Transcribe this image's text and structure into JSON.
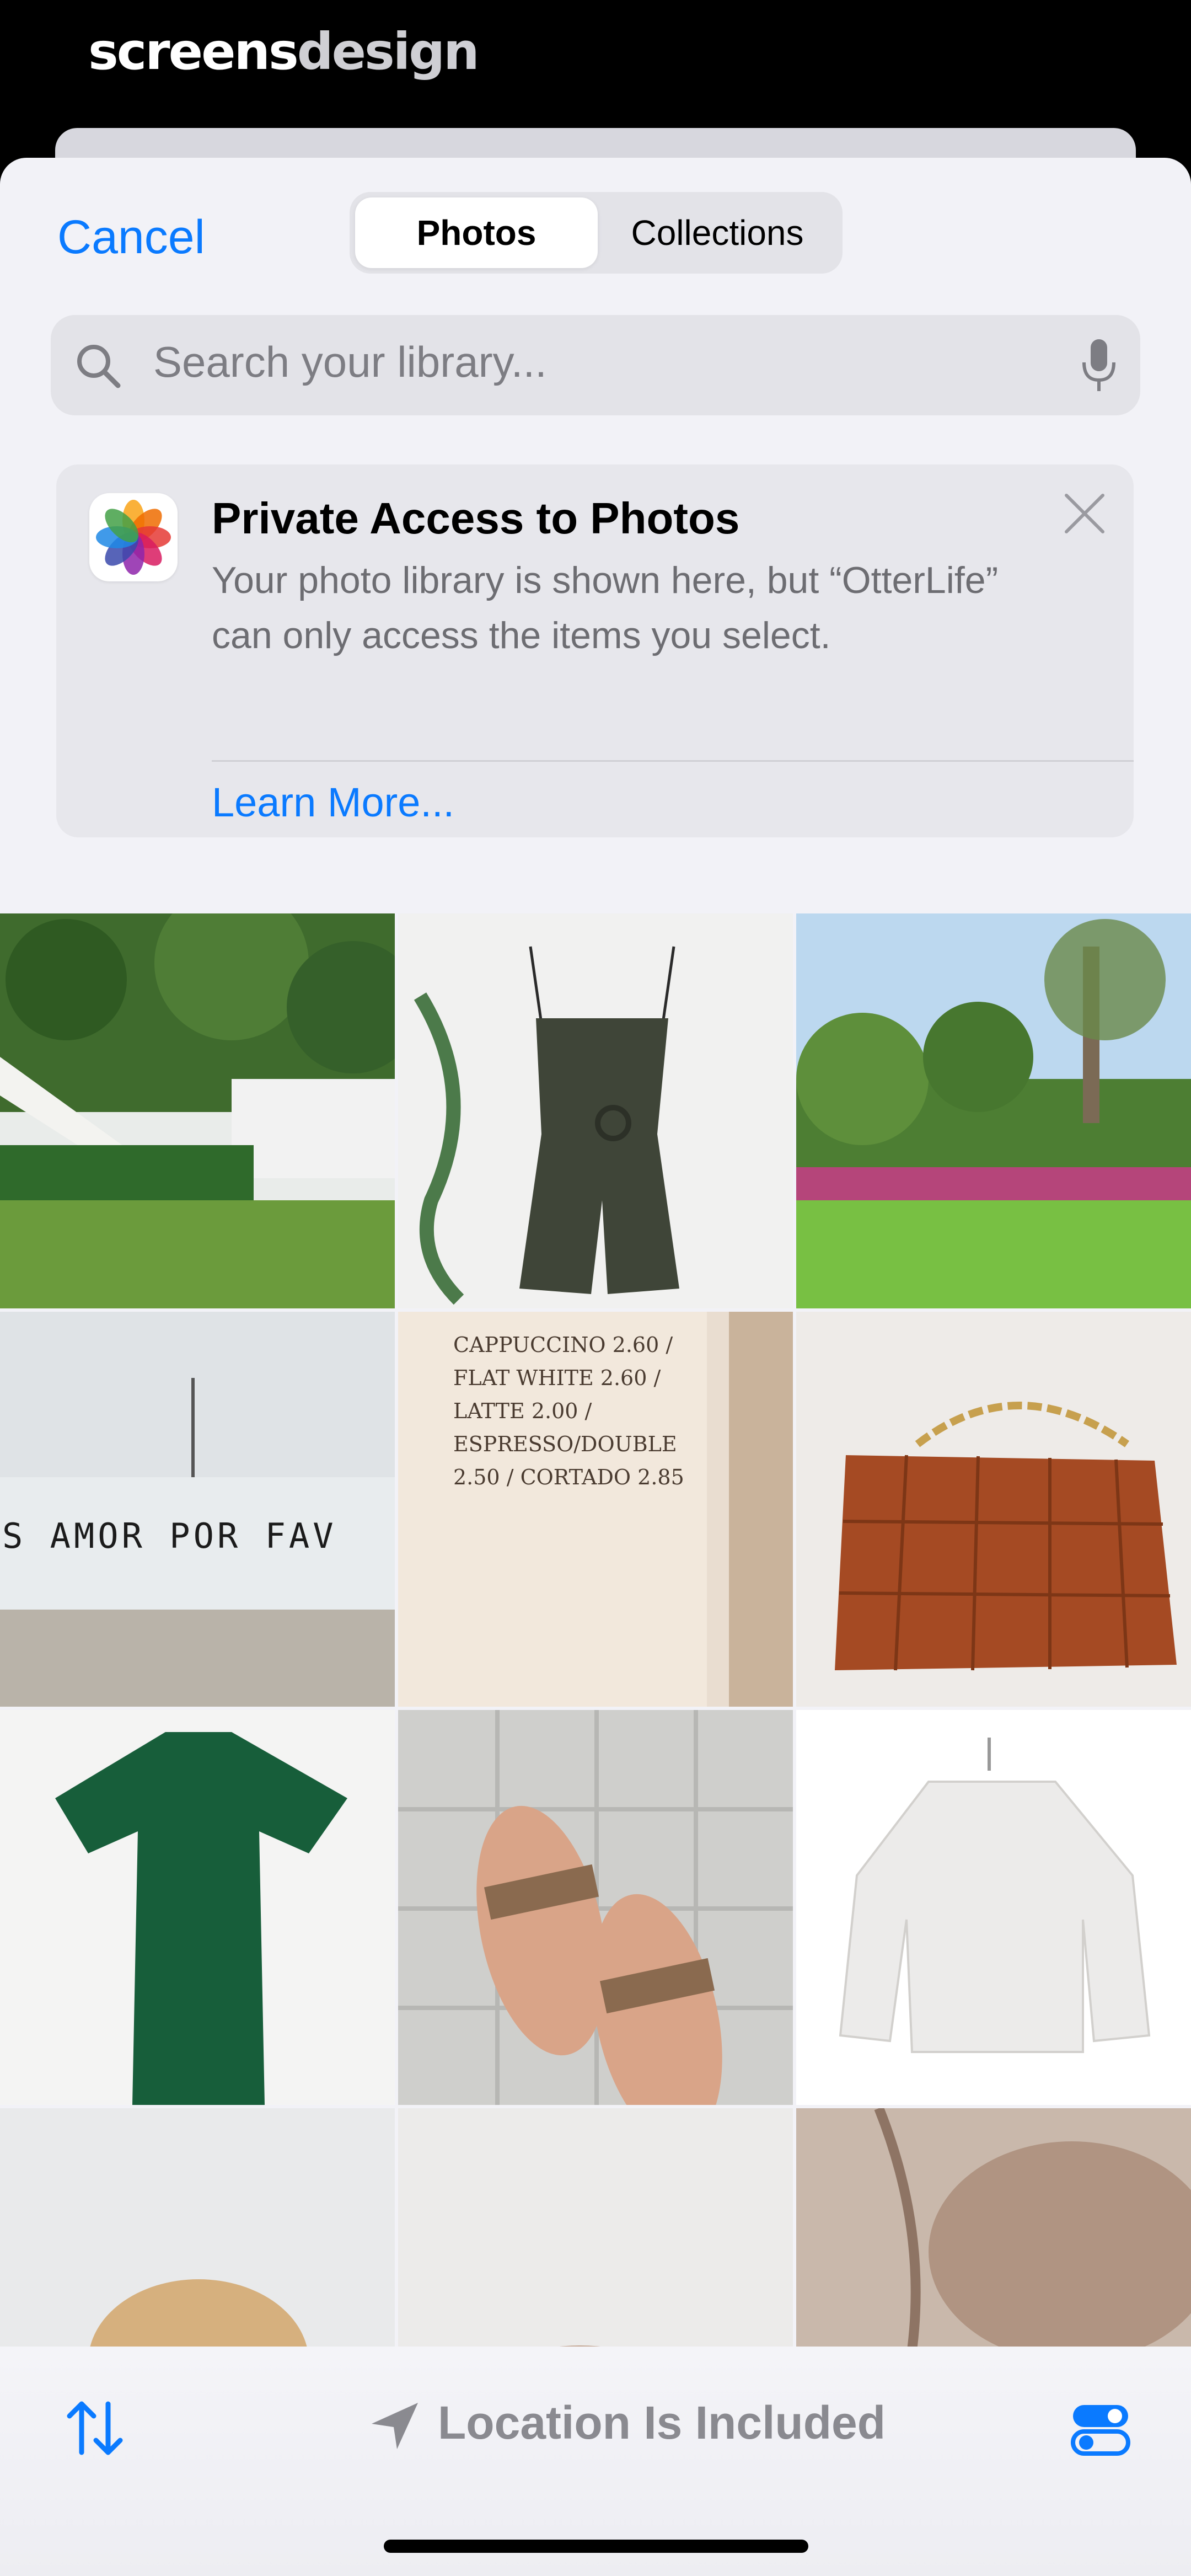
{
  "brand": {
    "part1": "screens",
    "part2": "design"
  },
  "header": {
    "cancel_label": "Cancel",
    "tabs": [
      {
        "label": "Photos",
        "selected": true
      },
      {
        "label": "Collections",
        "selected": false
      }
    ]
  },
  "search": {
    "placeholder": "Search your library..."
  },
  "notice": {
    "title": "Private Access to Photos",
    "body": "Your photo library is shown here, but “OtterLife” can only access the items you select.",
    "link_label": "Learn More..."
  },
  "grid": {
    "photos": [
      {
        "name": "garden-stairs"
      },
      {
        "name": "olive-romper"
      },
      {
        "name": "park-trees"
      },
      {
        "name": "amor-wall",
        "text": "S AMOR POR FAV"
      },
      {
        "name": "coffee-menu",
        "text": "CAPPUCCINO 2.60 / FLAT WHITE 2.60 / LATTE 2.00 / ESPRESSO/DOUBLE 2.50 / CORTADO 2.85"
      },
      {
        "name": "woven-bag"
      },
      {
        "name": "green-dress"
      },
      {
        "name": "sandals"
      },
      {
        "name": "white-jacket"
      },
      {
        "name": "hair-portrait"
      },
      {
        "name": "hand-photo"
      },
      {
        "name": "neck-portrait"
      }
    ]
  },
  "bottombar": {
    "location_label": "Location Is Included"
  },
  "colors": {
    "accent": "#0a7aff",
    "sheet": "#f2f2f7"
  }
}
